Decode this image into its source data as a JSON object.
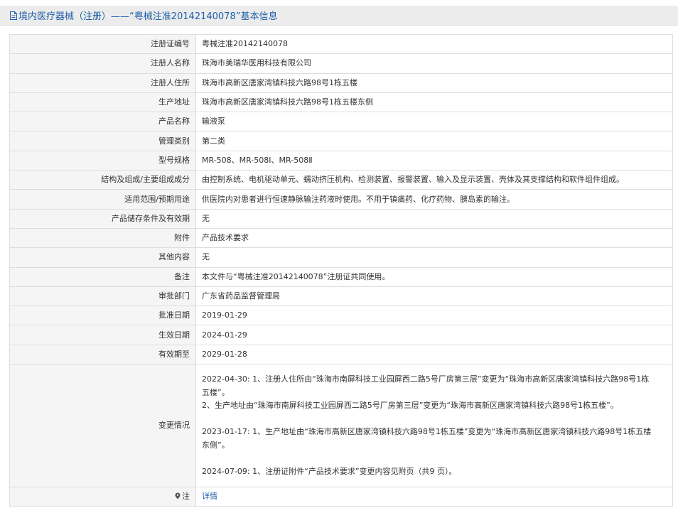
{
  "header": {
    "title": "境内医疗器械（注册）——“粤械注准20142140078”基本信息",
    "icon": "document-icon"
  },
  "fields": [
    {
      "label": "注册证编号",
      "value": "粤械注准20142140078"
    },
    {
      "label": "注册人名称",
      "value": "珠海市美瑞华医用科技有限公司"
    },
    {
      "label": "注册人住所",
      "value": "珠海市高新区唐家湾镇科技六路98号1栋五楼"
    },
    {
      "label": "生产地址",
      "value": "珠海市高新区唐家湾镇科技六路98号1栋五楼东侧"
    },
    {
      "label": "产品名称",
      "value": "输液泵"
    },
    {
      "label": "管理类别",
      "value": "第二类"
    },
    {
      "label": "型号规格",
      "value": "MR-508、MR-508Ⅰ、MR-508Ⅱ"
    },
    {
      "label": "结构及组成/主要组成成分",
      "value": "由控制系统、电机驱动单元、蠕动挤压机构、检测装置、报警装置、输入及显示装置、壳体及其支撑结构和软件组件组成。"
    },
    {
      "label": "适用范围/预期用途",
      "value": "供医院内对患者进行恒速静脉输注药液时使用。不用于镇痛药、化疗药物、胰岛素的输注。"
    },
    {
      "label": "产品储存条件及有效期",
      "value": "无"
    },
    {
      "label": "附件",
      "value": "产品技术要求"
    },
    {
      "label": "其他内容",
      "value": "无"
    },
    {
      "label": "备注",
      "value": "本文件与“粤械注准20142140078”注册证共同使用。"
    },
    {
      "label": "审批部门",
      "value": "广东省药品监督管理局"
    },
    {
      "label": "批准日期",
      "value": "2019-01-29"
    },
    {
      "label": "生效日期",
      "value": "2024-01-29"
    },
    {
      "label": "有效期至",
      "value": "2029-01-28"
    }
  ],
  "changes": {
    "label": "变更情况",
    "entries": [
      {
        "lines": [
          "2022-04-30: 1、注册人住所由“珠海市南屏科技工业园屏西二路5号厂房第三层”变更为“珠海市高新区唐家湾镇科技六路98号1栋",
          "五楼”。",
          "2、生产地址由“珠海市南屏科技工业园屏西二路5号厂房第三层”变更为“珠海市高新区唐家湾镇科技六路98号1栋五楼”。"
        ]
      },
      {
        "lines": [
          "2023-01-17: 1、生产地址由“珠海市高新区唐家湾镇科技六路98号1栋五楼”变更为“珠海市高新区唐家湾镇科技六路98号1栋五楼",
          "东侧”。"
        ]
      },
      {
        "lines": [
          "2024-07-09: 1、注册证附件“产品技术要求”变更内容见附页（共9 页）。"
        ]
      }
    ]
  },
  "note": {
    "label": "注",
    "icon": "location-pin-icon",
    "link_text": "详情",
    "link_color": "#1d5ea8"
  }
}
